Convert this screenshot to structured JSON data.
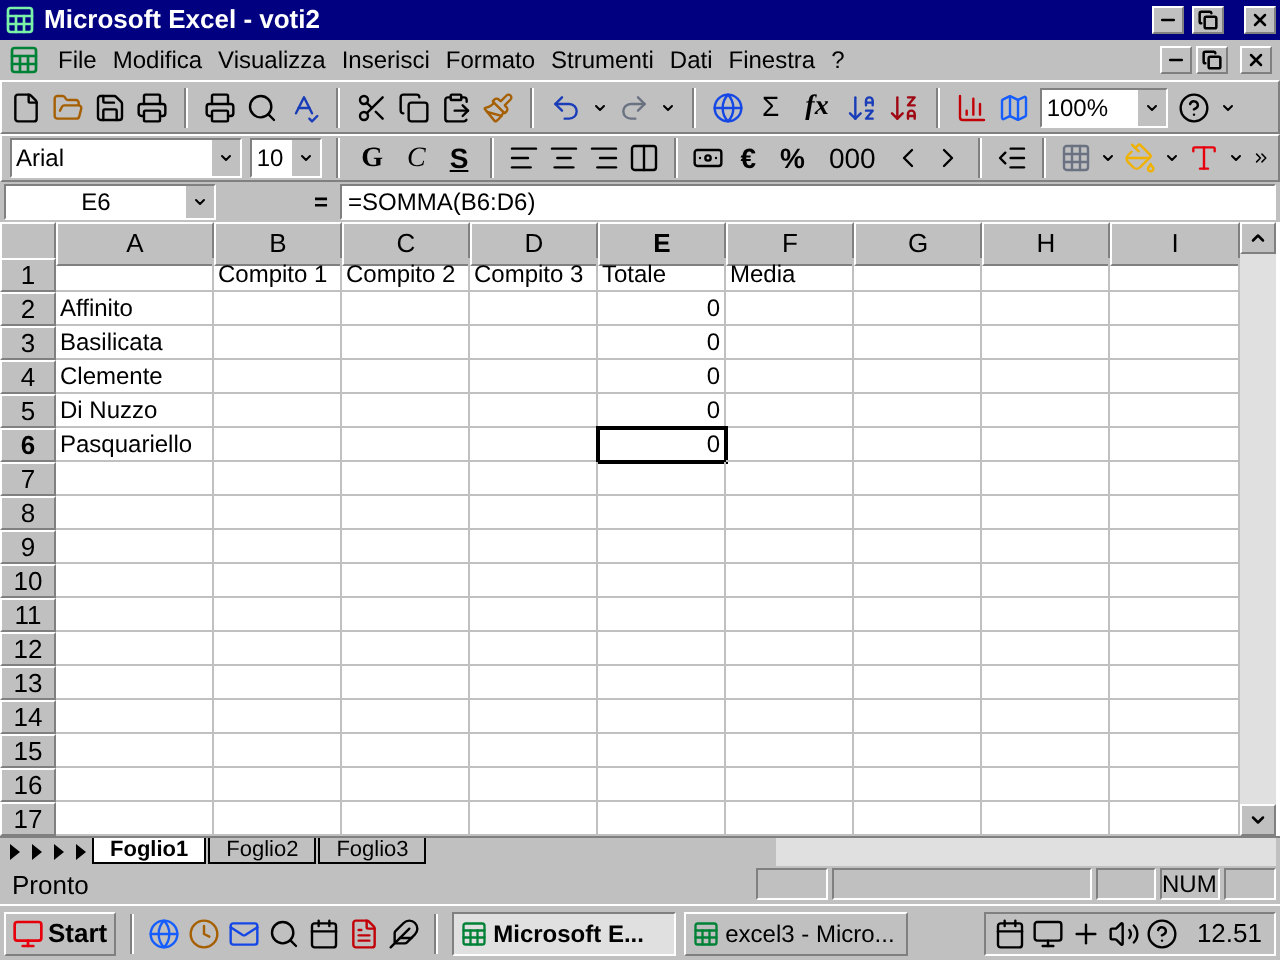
{
  "window": {
    "title": "Microsoft Excel - voti2"
  },
  "menu": [
    "File",
    "Modifica",
    "Visualizza",
    "Inserisci",
    "Formato",
    "Strumenti",
    "Dati",
    "Finestra",
    "?"
  ],
  "standard_toolbar": {
    "sum": "Σ",
    "function": "fx",
    "zoom": "100%"
  },
  "format_toolbar": {
    "font": "Arial",
    "size": "10",
    "bold": "G",
    "italic": "C",
    "underline": "S",
    "euro": "€",
    "percent": "%",
    "thousands": "000"
  },
  "formula_bar": {
    "name_box": "E6",
    "equals": "=",
    "formula": "=SOMMA(B6:D6)"
  },
  "columns": [
    {
      "label": "A",
      "selected": false
    },
    {
      "label": "B",
      "selected": false
    },
    {
      "label": "C",
      "selected": false
    },
    {
      "label": "D",
      "selected": false
    },
    {
      "label": "E",
      "selected": true
    },
    {
      "label": "F",
      "selected": false
    },
    {
      "label": "G",
      "selected": false
    },
    {
      "label": "H",
      "selected": false
    },
    {
      "label": "I",
      "selected": false
    }
  ],
  "rows": [
    {
      "header": "1",
      "selected": false,
      "cells": [
        null,
        {
          "text": "Compito 1",
          "kind": "text"
        },
        {
          "text": "Compito 2",
          "kind": "text"
        },
        {
          "text": "Compito 3",
          "kind": "text"
        },
        {
          "text": "Totale",
          "kind": "text"
        },
        {
          "text": "Media",
          "kind": "text"
        },
        null,
        null,
        null
      ]
    },
    {
      "header": "2",
      "selected": false,
      "cells": [
        {
          "text": "Affinito",
          "kind": "text"
        },
        null,
        null,
        null,
        {
          "text": "0",
          "kind": "number"
        },
        null,
        null,
        null,
        null
      ]
    },
    {
      "header": "3",
      "selected": false,
      "cells": [
        {
          "text": "Basilicata",
          "kind": "text"
        },
        null,
        null,
        null,
        {
          "text": "0",
          "kind": "number"
        },
        null,
        null,
        null,
        null
      ]
    },
    {
      "header": "4",
      "selected": false,
      "cells": [
        {
          "text": "Clemente",
          "kind": "text"
        },
        null,
        null,
        null,
        {
          "text": "0",
          "kind": "number"
        },
        null,
        null,
        null,
        null
      ]
    },
    {
      "header": "5",
      "selected": false,
      "cells": [
        {
          "text": "Di Nuzzo",
          "kind": "text"
        },
        null,
        null,
        null,
        {
          "text": "0",
          "kind": "number"
        },
        null,
        null,
        null,
        null
      ]
    },
    {
      "header": "6",
      "selected": true,
      "cells": [
        {
          "text": "Pasquariello",
          "kind": "text"
        },
        null,
        null,
        null,
        {
          "text": "0",
          "kind": "number"
        },
        null,
        null,
        null,
        null
      ]
    },
    {
      "header": "7",
      "selected": false,
      "cells": []
    },
    {
      "header": "8",
      "selected": false,
      "cells": []
    },
    {
      "header": "9",
      "selected": false,
      "cells": []
    },
    {
      "header": "10",
      "selected": false,
      "cells": []
    },
    {
      "header": "11",
      "selected": false,
      "cells": []
    },
    {
      "header": "12",
      "selected": false,
      "cells": []
    },
    {
      "header": "13",
      "selected": false,
      "cells": []
    },
    {
      "header": "14",
      "selected": false,
      "cells": []
    },
    {
      "header": "15",
      "selected": false,
      "cells": []
    },
    {
      "header": "16",
      "selected": false,
      "cells": []
    },
    {
      "header": "17",
      "selected": false,
      "cells": []
    }
  ],
  "sheet_tabs": [
    {
      "label": "Foglio1",
      "selected": true
    },
    {
      "label": "Foglio2",
      "selected": false
    },
    {
      "label": "Foglio3",
      "selected": false
    }
  ],
  "status_bar": {
    "text": "Pronto",
    "indicator": "NUM"
  },
  "taskbar": {
    "start": "Start",
    "tasks": [
      {
        "label": "Microsoft E...",
        "selected": true
      },
      {
        "label": "excel3 - Micro...",
        "selected": false
      }
    ],
    "clock": "12.51"
  }
}
